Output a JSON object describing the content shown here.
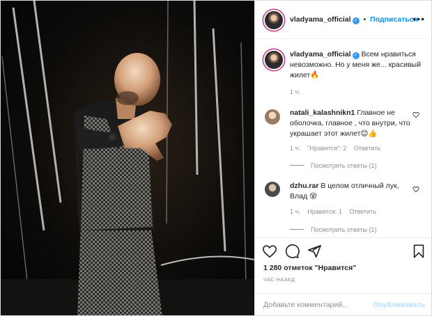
{
  "post": {
    "image_alt": "bald man in checkered vest raising hand"
  },
  "header": {
    "username": "vladyama_official",
    "separator": "•",
    "follow_label": "Подписаться",
    "more_icon": "more-options-icon",
    "more_glyph": "•••"
  },
  "caption": {
    "username": "vladyama_official",
    "text": "Всем нравиться невозможно. Но у меня же... красивый жилет🔥",
    "time": "1 ч."
  },
  "comments": [
    {
      "username": "natali_kalashnikn1",
      "text": "Главное не оболочка, главное , что внутри, что украшает этот жилет😊👍",
      "time": "1 ч.",
      "likes": "\"Нравится\": 2",
      "reply": "Ответить",
      "view_replies": "Посмотреть ответы (1)"
    },
    {
      "username": "dzhu.rar",
      "text": "В целом отличный лук, Влад 😵",
      "time": "1 ч.",
      "likes": "Нравится: 1",
      "reply": "Ответить",
      "view_replies": "Посмотреть ответы (1)"
    }
  ],
  "actions": {
    "likes_count": "1 280 отметок \"Нравится\"",
    "time_ago": "ЧАС НАЗАД"
  },
  "add_comment": {
    "placeholder": "Добавьте комментарий...",
    "publish_label": "Опубликовать"
  },
  "colors": {
    "accent": "#0095f6",
    "muted": "#8e8e8e",
    "border": "#efefef"
  }
}
